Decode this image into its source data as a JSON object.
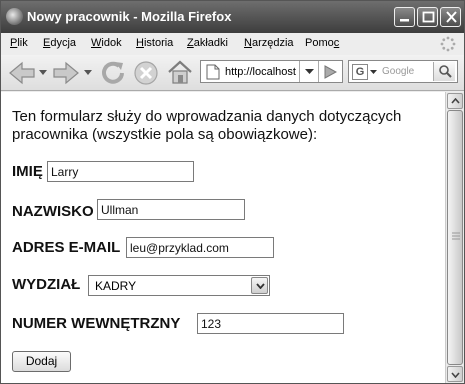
{
  "window": {
    "title": "Nowy pracownik - Mozilla Firefox",
    "icons": [
      "firefox-icon",
      "minimize-icon",
      "maximize-icon",
      "close-icon"
    ]
  },
  "menu": {
    "items": [
      {
        "first": "P",
        "rest": "lik"
      },
      {
        "first": "E",
        "rest": "dycja"
      },
      {
        "first": "W",
        "rest": "idok"
      },
      {
        "first": "H",
        "rest": "istoria"
      },
      {
        "first": "Z",
        "rest": "akładki"
      },
      {
        "first": "N",
        "rest": "arzędzia"
      },
      {
        "first": "",
        "mid_pre": "Pomo",
        "mid_ul": "c",
        "rest": ""
      }
    ]
  },
  "toolbar": {
    "url": "http://localhost",
    "search_placeholder": "Google",
    "search_engine_letter": "G",
    "icons": [
      "back-icon",
      "forward-icon",
      "reload-icon",
      "stop-icon",
      "home-icon",
      "page-icon",
      "go-icon",
      "search-icon"
    ]
  },
  "form": {
    "intro": "Ten formularz służy do wprowadzania danych dotyczących pracownika (wszystkie pola są obowiązkowe):",
    "first_name_label": "IMIĘ",
    "first_name_value": "Larry",
    "last_name_label": "NAZWISKO",
    "last_name_value": "Ullman",
    "email_label": "ADRES E-MAIL",
    "email_value": "leu@przyklad.com",
    "department_label": "WYDZIAŁ",
    "department_value": "KADRY",
    "phone_label": "NUMER WEWNĘTRZNY",
    "phone_value": "123",
    "submit_label": "Dodaj"
  }
}
